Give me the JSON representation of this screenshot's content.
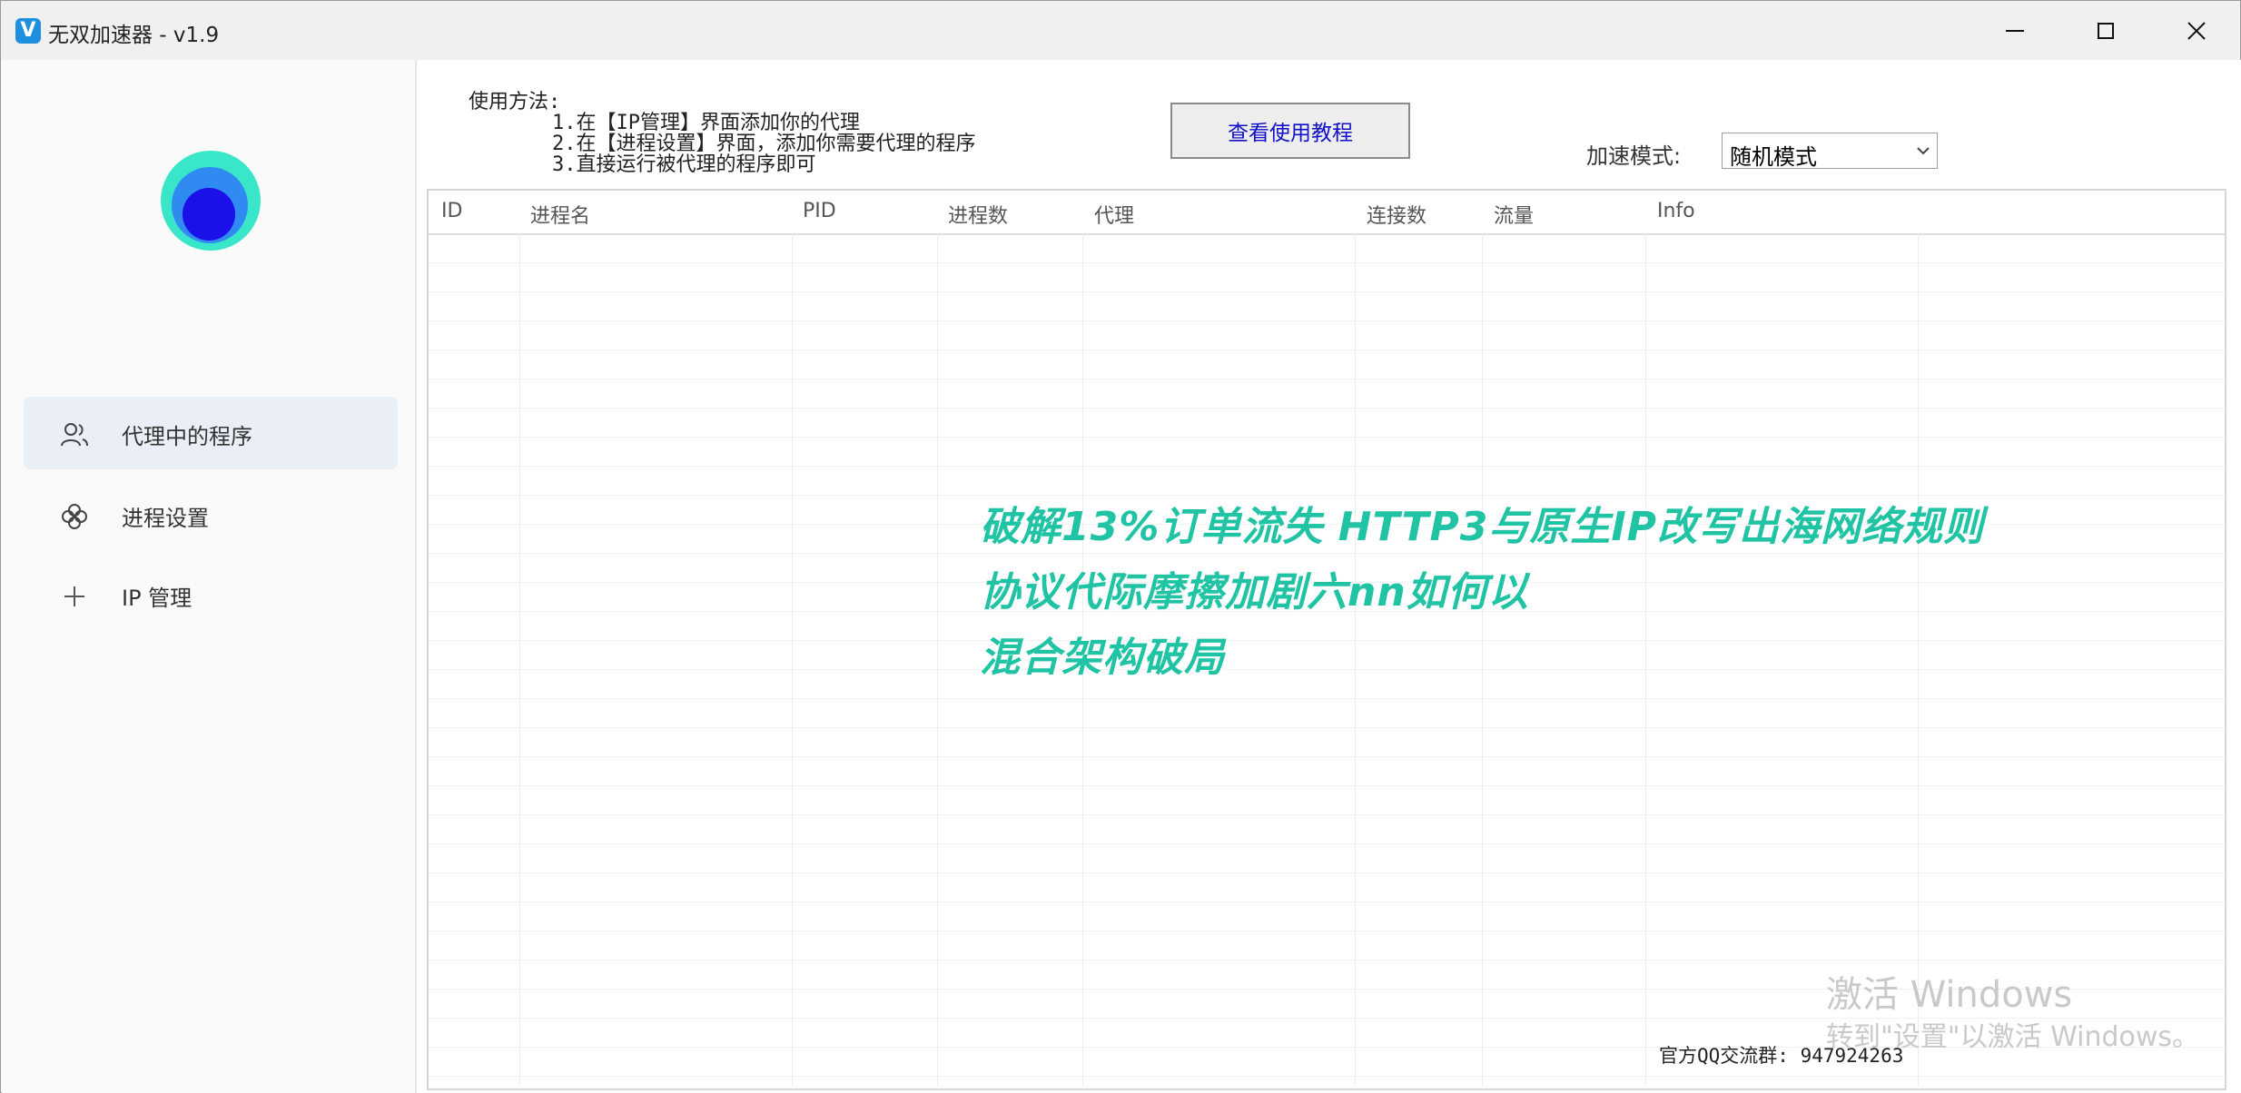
{
  "window": {
    "title": "无双加速器 - v1.9",
    "app_icon_letter": "V"
  },
  "sidebar": {
    "items": [
      {
        "label": "代理中的程序",
        "icon": "user-group-icon",
        "active": true
      },
      {
        "label": "进程设置",
        "icon": "process-settings-icon",
        "active": false
      },
      {
        "label": "IP 管理",
        "icon": "plus-icon",
        "active": false
      }
    ]
  },
  "usage": {
    "title": "使用方法:",
    "steps": [
      "1.在【IP管理】界面添加你的代理",
      "2.在【进程设置】界面，添加你需要代理的程序",
      "3.直接运行被代理的程序即可"
    ]
  },
  "toolbar": {
    "tutorial_button": "查看使用教程",
    "mode_label": "加速模式:",
    "mode_value": "随机模式"
  },
  "table": {
    "columns": [
      "ID",
      "进程名",
      "PID",
      "进程数",
      "代理",
      "连接数",
      "流量",
      "Info"
    ],
    "rows": []
  },
  "overlay": {
    "lines": [
      "破解13%订单流失 HTTP3与原生IP改写出海网络规则",
      "协议代际摩擦加剧六nn如何以",
      "混合架构破局"
    ],
    "color": "#20c3a3"
  },
  "watermark": {
    "title": "激活 Windows",
    "subtitle": "转到\"设置\"以激活 Windows。"
  },
  "footer": {
    "qq_group": "官方QQ交流群: 947924263"
  }
}
